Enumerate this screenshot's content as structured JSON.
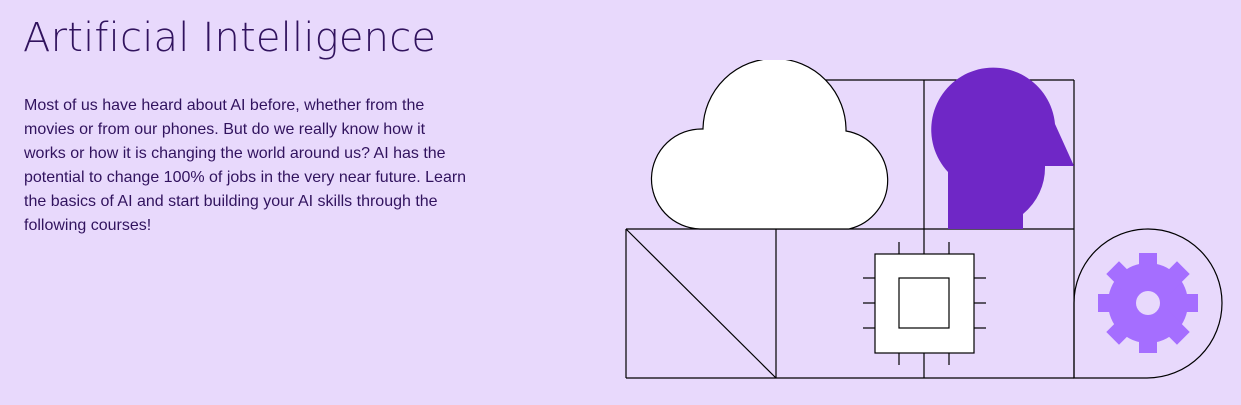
{
  "hero": {
    "title": "Artificial Intelligence",
    "body": "Most of us have heard about AI before, whether from the movies or from our phones. But do we really know how it works or how it is changing the world around us? AI has the potential to change 100% of jobs in the very near future. Learn the basics of AI and start building your AI skills through the following courses!"
  },
  "illustration": {
    "icons": [
      "cloud-icon",
      "head-silhouette-icon",
      "diagonal-split-icon",
      "chip-icon",
      "gear-icon"
    ]
  },
  "colors": {
    "background": "#e8d9fc",
    "text": "#31135e",
    "head": "#6f27c6",
    "gear": "#a56eff",
    "outline": "#000000",
    "cloud_fill": "#ffffff"
  }
}
